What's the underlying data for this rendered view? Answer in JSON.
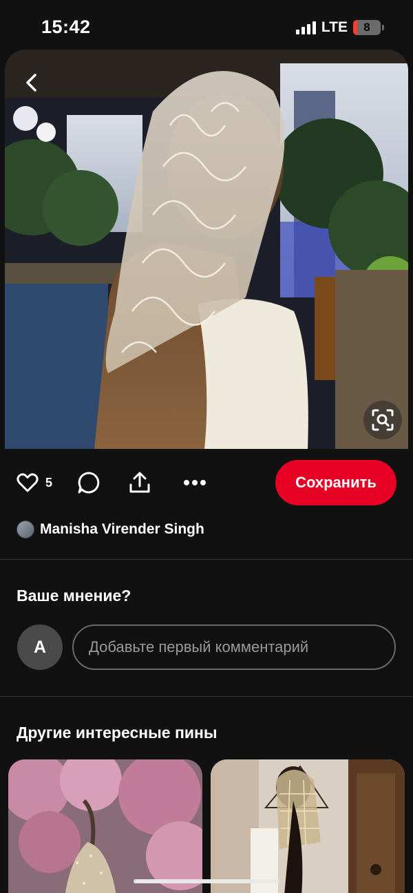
{
  "status_bar": {
    "time": "15:42",
    "network": "LTE",
    "battery_level": "8"
  },
  "pin": {
    "like_count": "5",
    "save_label": "Сохранить",
    "author_name": "Manisha Virender Singh"
  },
  "comments": {
    "title": "Ваше мнение?",
    "user_initial": "A",
    "placeholder": "Добавьте первый комментарий"
  },
  "more_pins": {
    "title": "Другие интересные пины"
  },
  "colors": {
    "background": "#111111",
    "save_button": "#e60023",
    "divider": "#3a3a3a"
  },
  "icons": [
    "back-arrow-icon",
    "visual-search-icon",
    "heart-icon",
    "comment-icon",
    "share-icon",
    "more-icon"
  ]
}
